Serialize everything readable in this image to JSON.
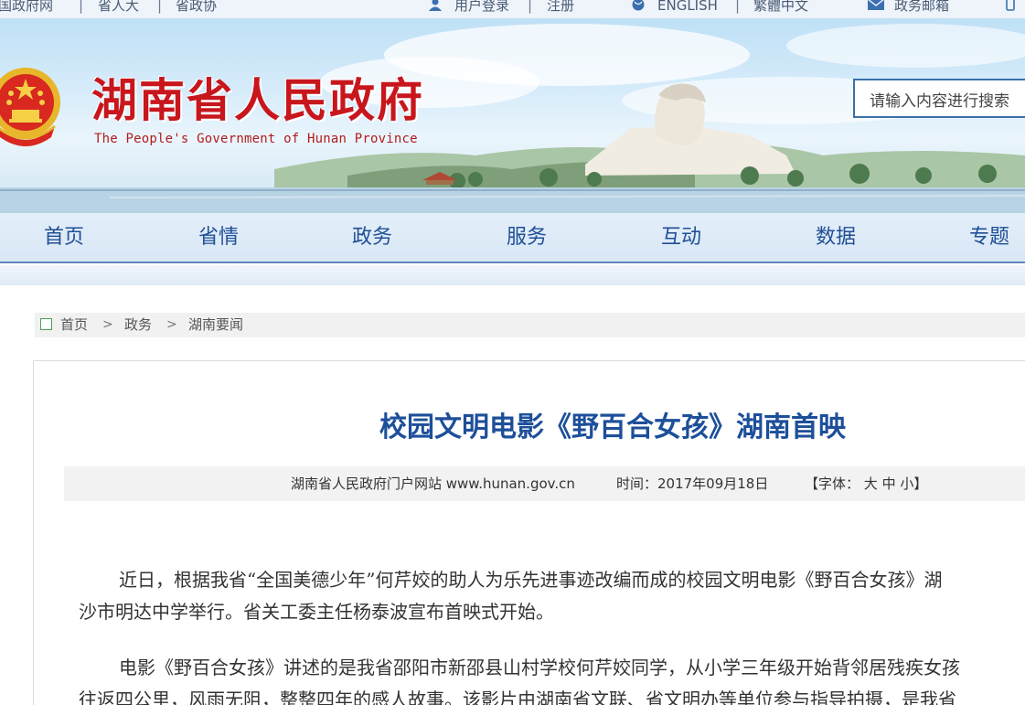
{
  "topbar": {
    "gov_site": "国政府网",
    "npc": "省人大",
    "cppcc": "省政协",
    "login": "用户登录",
    "register": "注册",
    "english": "ENGLISH",
    "traditional": "繁體中文",
    "mailbox": "政务邮箱",
    "icons": [
      "user-icon",
      "globe-icon",
      "mail-icon",
      "phone-icon"
    ]
  },
  "header": {
    "title": "湖南省人民政府",
    "subtitle": "The People's Government of Hunan Province",
    "search_placeholder": "请输入内容进行搜索",
    "title_color": "#c8161d"
  },
  "nav": {
    "items": [
      "首页",
      "省情",
      "政务",
      "服务",
      "互动",
      "数据",
      "专题"
    ],
    "color": "#1f4f96"
  },
  "breadcrumb": {
    "items": [
      "首页",
      "政务",
      "湖南要闻"
    ],
    "separator": ">"
  },
  "article": {
    "title": "校园文明电影《野百合女孩》湖南首映",
    "source": "湖南省人民政府门户网站 www.hunan.gov.cn",
    "time": "时间：2017年09月18日",
    "font_size_prefix": "【字体：",
    "font_large": "大",
    "font_medium": "中",
    "font_small": "小",
    "font_size_suffix": "】",
    "paragraphs": [
      {
        "line1": "近日，根据我省“全国美德少年”何芹姣的助人为乐先进事迹改编而成的校园文明电影《野百合女孩》湖",
        "line2": "沙市明达中学举行。省关工委主任杨泰波宣布首映式开始。"
      },
      {
        "line1": "电影《野百合女孩》讲述的是我省邵阳市新邵县山村学校何芹姣同学，从小学三年级开始背邻居残疾女孩",
        "line2": "往返四公里，风雨无阻，整整四年的感人故事。该影片由湖南省文联、省文明办等单位参与指导拍摄，是我省"
      }
    ]
  }
}
